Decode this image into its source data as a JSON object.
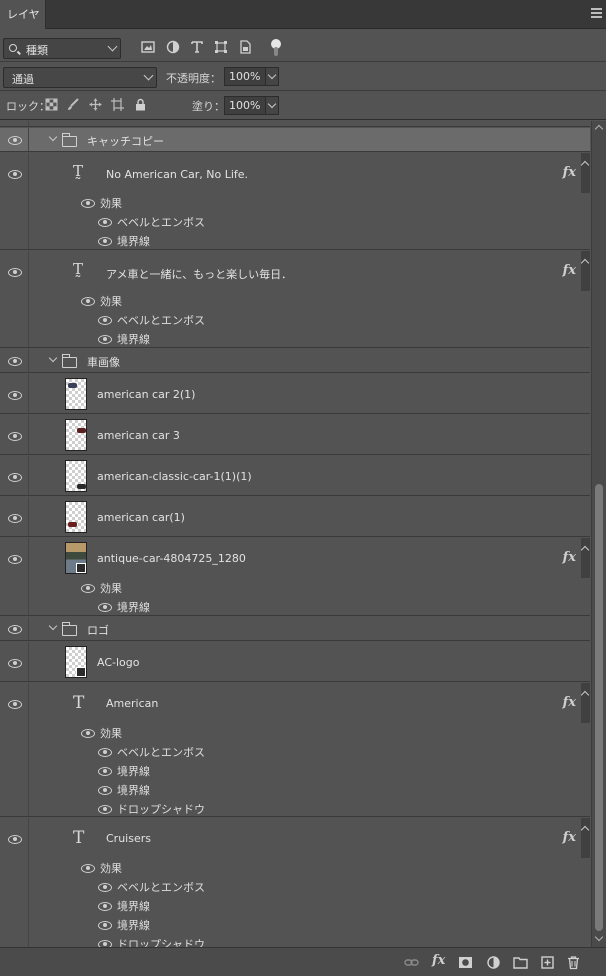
{
  "panel": {
    "tab_label": "レイヤー"
  },
  "filter": {
    "kind_label": "種類"
  },
  "blend": {
    "mode": "通過",
    "opacity_label": "不透明度：",
    "opacity_value": "100%"
  },
  "lock": {
    "label": "ロック：",
    "fill_label": "塗り：",
    "fill_value": "100%"
  },
  "effects_label": "効果",
  "layers": {
    "g1": {
      "name": "キャッチコピー"
    },
    "t1": {
      "name": "No American Car, No Life.",
      "fx1": "ベベルとエンボス",
      "fx2": "境界線"
    },
    "t2": {
      "name": "アメ車と一緒に、もっと楽しい毎日．",
      "fx1": "ベベルとエンボス",
      "fx2": "境界線"
    },
    "g2": {
      "name": "車画像"
    },
    "i1": {
      "name": "american car 2(1)"
    },
    "i2": {
      "name": "american car 3"
    },
    "i3": {
      "name": "american-classic-car-1(1)(1)"
    },
    "i4": {
      "name": "american car(1)"
    },
    "i5": {
      "name": "antique-car-4804725_1280",
      "fx1": "境界線"
    },
    "g3": {
      "name": "ロゴ"
    },
    "l1": {
      "name": "AC-logo"
    },
    "t3": {
      "name": "American",
      "fx1": "ベベルとエンボス",
      "fx2": "境界線",
      "fx3": "境界線",
      "fx4": "ドロップシャドウ"
    },
    "t4": {
      "name": "Cruisers",
      "fx1": "ベベルとエンボス",
      "fx2": "境界線",
      "fx3": "境界線",
      "fx4": "ドロップシャドウ"
    }
  },
  "fx_badge": "fx"
}
